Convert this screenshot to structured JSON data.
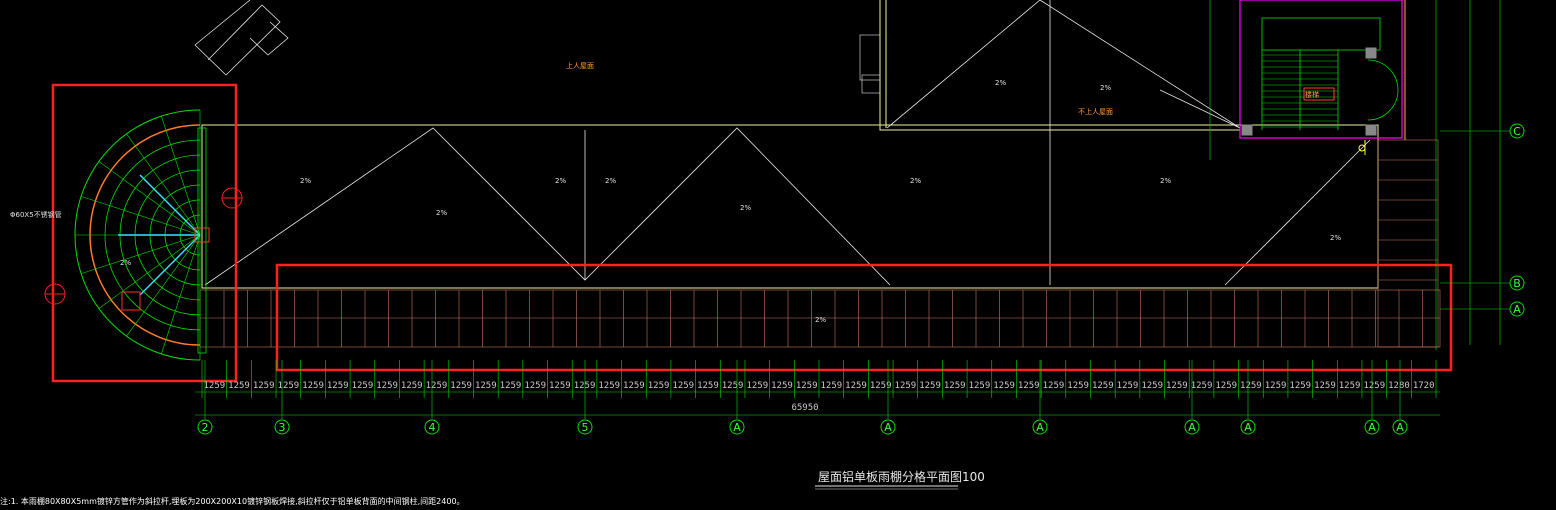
{
  "drawing": {
    "title": "屋面铝单板雨棚分格平面图100",
    "note": "注:1. 本雨棚80X80X5mm镀锌方管作为斜拉杆,埋板为200X200X10镀锌钢板焊接,斜拉杆仅于铝单板背面的中间钢柱,间距2400。",
    "total_dim": "65950",
    "pipe_label": "Φ60X5不锈钢管",
    "stair_label": "楼梯",
    "roof_labels": [
      "上人屋面",
      "不上人屋面"
    ],
    "slope_labels": [
      "2%",
      "2%",
      "2%",
      "2%",
      "2%",
      "2%",
      "2%",
      "2%",
      "2%",
      "2%",
      "2%",
      "2%"
    ],
    "axes_bottom": [
      "2",
      "3",
      "4",
      "5",
      "A",
      "A",
      "A",
      "A",
      "A",
      "A",
      "A"
    ],
    "axes_right": [
      "C",
      "B",
      "A"
    ]
  },
  "dims": {
    "bottom": [
      "1259",
      "1259",
      "1259",
      "1259",
      "1259",
      "1259",
      "1259",
      "1259",
      "1259",
      "1259",
      "1259",
      "1259",
      "1259",
      "1259",
      "1259",
      "1259",
      "1259",
      "1259",
      "1259",
      "1259",
      "1259",
      "1259",
      "1259",
      "1259",
      "1259",
      "1259",
      "1259",
      "1259",
      "1259",
      "1259",
      "1259",
      "1259",
      "1259",
      "1259",
      "1259",
      "1259",
      "1259",
      "1259",
      "1259",
      "1259",
      "1259",
      "1259",
      "1259",
      "1259",
      "1259",
      "1259",
      "1259",
      "1259",
      "1280",
      "1720"
    ]
  },
  "colors": {
    "highlight": "#ff2020",
    "axis": "#00e000",
    "panel": "#c87860",
    "building": "#f0f0a0",
    "line": "#e8e8e8",
    "stair": "#ff00ff"
  }
}
